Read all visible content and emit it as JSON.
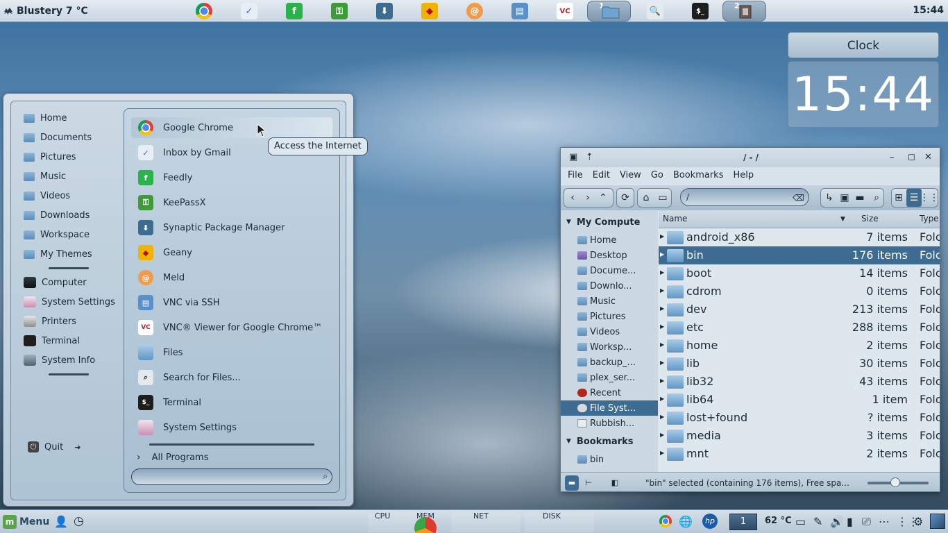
{
  "top_panel": {
    "weather": "Blustery 7 °C",
    "clock": "15:44",
    "launchers": [
      {
        "name": "chrome-icon"
      },
      {
        "name": "inbox-icon"
      },
      {
        "name": "feedly-icon"
      },
      {
        "name": "keepassx-icon"
      },
      {
        "name": "synaptic-icon"
      },
      {
        "name": "geany-icon"
      },
      {
        "name": "meld-icon"
      },
      {
        "name": "vnc-icon"
      },
      {
        "name": "vnc-viewer-icon"
      }
    ],
    "workspaces": [
      {
        "num": "1"
      },
      {
        "num": "2"
      }
    ]
  },
  "desklet": {
    "title": "Clock",
    "time": "15:44"
  },
  "menu": {
    "places": [
      {
        "label": "Home"
      },
      {
        "label": "Documents"
      },
      {
        "label": "Pictures"
      },
      {
        "label": "Music"
      },
      {
        "label": "Videos"
      },
      {
        "label": "Downloads"
      },
      {
        "label": "Workspace"
      },
      {
        "label": "My Themes"
      }
    ],
    "system": [
      {
        "label": "Computer"
      },
      {
        "label": "System Settings"
      },
      {
        "label": "Printers"
      },
      {
        "label": "Terminal"
      },
      {
        "label": "System Info"
      }
    ],
    "quit": "Quit",
    "apps": [
      {
        "label": "Google Chrome"
      },
      {
        "label": "Inbox by Gmail"
      },
      {
        "label": "Feedly"
      },
      {
        "label": "KeePassX"
      },
      {
        "label": "Synaptic Package Manager"
      },
      {
        "label": "Geany"
      },
      {
        "label": "Meld"
      },
      {
        "label": "VNC via SSH"
      },
      {
        "label": "VNC® Viewer for Google Chrome™"
      },
      {
        "label": "Files"
      },
      {
        "label": "Search for Files..."
      },
      {
        "label": "Terminal"
      },
      {
        "label": "System Settings"
      }
    ],
    "all_programs": "All Programs",
    "search_placeholder": "",
    "tooltip": "Access the Internet"
  },
  "file_manager": {
    "title": "/ - /",
    "menubar": [
      "File",
      "Edit",
      "View",
      "Go",
      "Bookmarks",
      "Help"
    ],
    "location": "/",
    "sidebar": {
      "computer_header": "My Compute",
      "items": [
        {
          "label": "Home"
        },
        {
          "label": "Desktop"
        },
        {
          "label": "Docume..."
        },
        {
          "label": "Downlo..."
        },
        {
          "label": "Music"
        },
        {
          "label": "Pictures"
        },
        {
          "label": "Videos"
        },
        {
          "label": "Worksp..."
        },
        {
          "label": "backup_..."
        },
        {
          "label": "plex_ser..."
        },
        {
          "label": "Recent"
        },
        {
          "label": "File Syst..."
        },
        {
          "label": "Rubbish..."
        }
      ],
      "bookmarks_header": "Bookmarks",
      "bookmarks": [
        {
          "label": "bin"
        }
      ]
    },
    "columns": {
      "name": "Name",
      "size": "Size",
      "type": "Type"
    },
    "rows": [
      {
        "name": "android_x86",
        "size": "7 items",
        "type": "Folc"
      },
      {
        "name": "bin",
        "size": "176 items",
        "type": "Folc"
      },
      {
        "name": "boot",
        "size": "14 items",
        "type": "Folc"
      },
      {
        "name": "cdrom",
        "size": "0 items",
        "type": "Folc"
      },
      {
        "name": "dev",
        "size": "213 items",
        "type": "Folc"
      },
      {
        "name": "etc",
        "size": "288 items",
        "type": "Folc"
      },
      {
        "name": "home",
        "size": "2 items",
        "type": "Folc"
      },
      {
        "name": "lib",
        "size": "30 items",
        "type": "Folc"
      },
      {
        "name": "lib32",
        "size": "43 items",
        "type": "Folc"
      },
      {
        "name": "lib64",
        "size": "1 item",
        "type": "Folc"
      },
      {
        "name": "lost+found",
        "size": "? items",
        "type": "Folc"
      },
      {
        "name": "media",
        "size": "3 items",
        "type": "Folc"
      },
      {
        "name": "mnt",
        "size": "2 items",
        "type": "Folc"
      }
    ],
    "status": "\"bin\" selected (containing 176 items), Free spa...",
    "zoom_level": 0.45
  },
  "bottom_panel": {
    "menu_label": "Menu",
    "monitors": [
      {
        "label": "CPU"
      },
      {
        "label": "MEM"
      },
      {
        "label": "NET"
      },
      {
        "label": "DISK"
      }
    ],
    "workspace": "1",
    "temperature": "62 °C"
  },
  "colors": {
    "panel": "#c9d6e1",
    "selection": "#3e6b92",
    "folder": "#5f97c6",
    "menu_green": "#5aa34a"
  }
}
